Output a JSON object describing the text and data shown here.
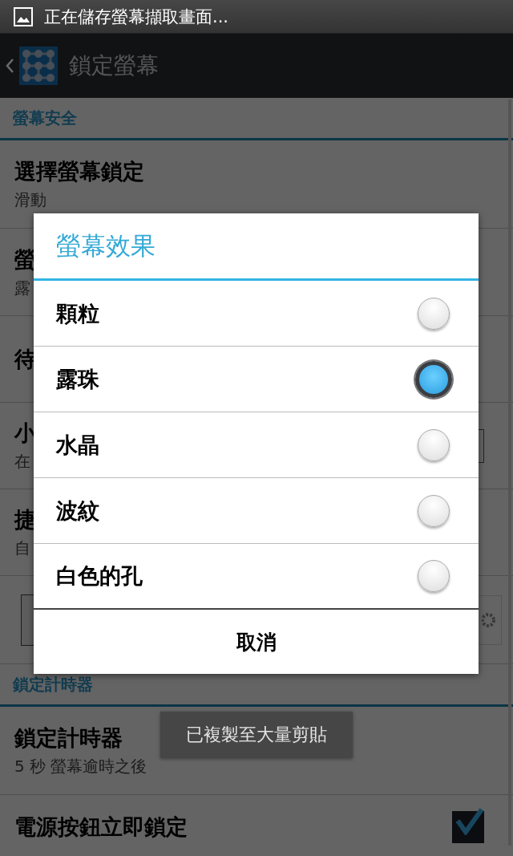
{
  "status_bar": {
    "notification": "正在儲存螢幕擷取畫面..."
  },
  "action_bar": {
    "title": "鎖定螢幕"
  },
  "sections": [
    {
      "header": "螢幕安全",
      "items": [
        {
          "kind": "text",
          "title": "選擇螢幕鎖定",
          "summary": "滑動"
        },
        {
          "kind": "text",
          "title": "螢",
          "summary": "露"
        },
        {
          "kind": "text",
          "title": "待"
        },
        {
          "kind": "checkbox",
          "title": "小",
          "summary": "在"
        },
        {
          "kind": "text",
          "title": "捷",
          "summary": "自"
        },
        {
          "kind": "widget"
        }
      ]
    },
    {
      "header": "鎖定計時器",
      "items": [
        {
          "kind": "text",
          "title": "鎖定計時器",
          "summary": "5 秒 螢幕逾時之後"
        },
        {
          "kind": "checkbox",
          "title": "電源按鈕立即鎖定",
          "checked": true
        }
      ]
    }
  ],
  "dialog": {
    "title": "螢幕效果",
    "options": [
      {
        "label": "顆粒",
        "selected": false
      },
      {
        "label": "露珠",
        "selected": true
      },
      {
        "label": "水晶",
        "selected": false
      },
      {
        "label": "波紋",
        "selected": false
      },
      {
        "label": "白色的孔",
        "selected": false
      }
    ],
    "cancel": "取消"
  },
  "toast": "已複製至大量剪貼"
}
